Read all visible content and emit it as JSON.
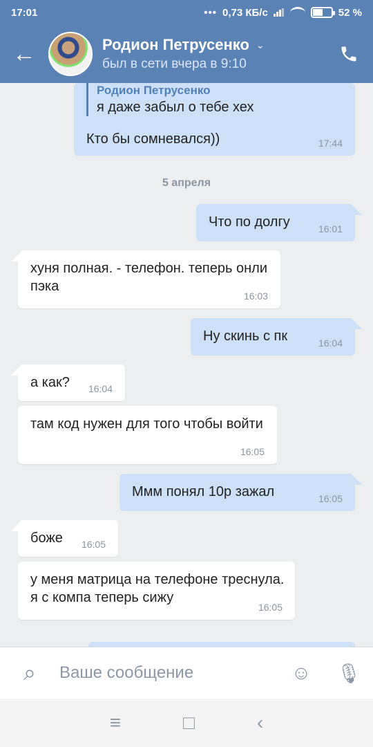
{
  "status_bar": {
    "time": "17:01",
    "network": "0,73 КБ/с",
    "battery": "52 %"
  },
  "header": {
    "name": "Родион Петрусенко",
    "status": "был в сети вчера в 9:10"
  },
  "date_separator": "5 апреля",
  "messages": {
    "m0_reply_author": "Родион Петрусенко",
    "m0_reply_text": "я даже забыл о тебе хех",
    "m0_text": "Кто бы сомневался))",
    "m0_time": "17:44",
    "m1_text": "Что по долгу",
    "m1_time": "16:01",
    "m2_text": "хуня полная. - телефон. теперь онли пэка",
    "m2_time": "16:03",
    "m3_text": "Ну скинь с пк",
    "m3_time": "16:04",
    "m4_text": "а как?",
    "m4_time": "16:04",
    "m5_text": "там код нужен для того чтобы войти",
    "m5_time": "16:05",
    "m6_text": "Ммм понял 10р зажал",
    "m6_time": "16:05",
    "m7_text": "боже",
    "m7_time": "16:05",
    "m8_text": "у меня матрица на телефоне треснула. я с компа теперь сижу",
    "m8_time": "16:05"
  },
  "composer": {
    "placeholder": "Ваше сообщение"
  },
  "icons": {
    "back": "arrow-left-icon",
    "call": "phone-icon",
    "attach": "paperclip-icon",
    "emoji": "smile-icon",
    "microphone": "microphone-icon"
  }
}
